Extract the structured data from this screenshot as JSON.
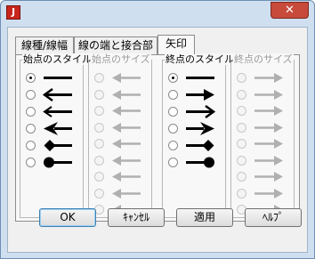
{
  "window": {
    "app_icon_letter": "J",
    "close_glyph": "✕"
  },
  "tabs": [
    {
      "label": "線種/線幅"
    },
    {
      "label": "線の端と接合部"
    },
    {
      "label": "矢印",
      "selected": true
    }
  ],
  "groups": [
    {
      "title": "始点のスタイル",
      "enabled": true,
      "direction": "start",
      "selected_index": 0,
      "options": [
        "none",
        "open-arrow",
        "thin-arrow",
        "stealth-arrow",
        "diamond",
        "round"
      ]
    },
    {
      "title": "始点のサイズ",
      "enabled": false,
      "direction": "start",
      "options": [
        "size-1",
        "size-2",
        "size-3",
        "size-4",
        "size-5",
        "size-6",
        "size-7",
        "size-8",
        "size-9"
      ]
    },
    {
      "title": "終点のスタイル",
      "enabled": true,
      "direction": "end",
      "selected_index": 0,
      "options": [
        "none",
        "triangle-arrow",
        "open-arrow",
        "stealth-arrow",
        "diamond",
        "round"
      ]
    },
    {
      "title": "終点のサイズ",
      "enabled": false,
      "direction": "end",
      "options": [
        "size-1",
        "size-2",
        "size-3",
        "size-4",
        "size-5",
        "size-6",
        "size-7",
        "size-8",
        "size-9"
      ]
    }
  ],
  "buttons": {
    "ok": "OK",
    "cancel": "ｷｬﾝｾﾙ",
    "apply": "適用",
    "help": "ﾍﾙﾌﾟ"
  },
  "colors": {
    "enabled_arrow": "#000000",
    "disabled_arrow": "#b0b0b0"
  }
}
